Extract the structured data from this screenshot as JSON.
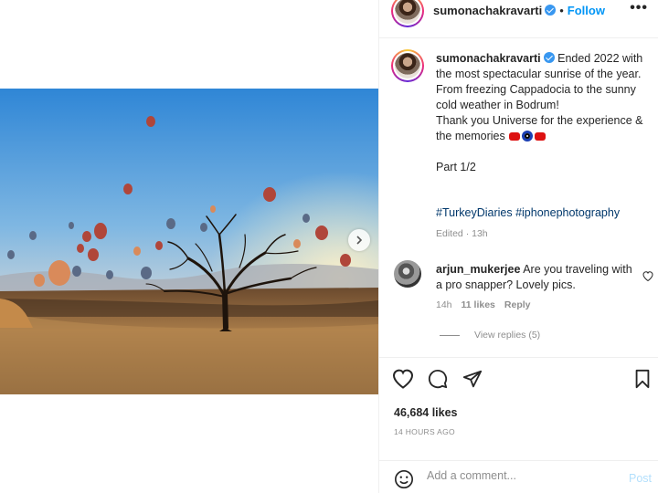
{
  "post": {
    "username": "sumonachakravarti",
    "follow_label": "Follow",
    "dot": "•",
    "more_icon": "more-horizontal-icon",
    "caption_text": " Ended 2022 with the most spectacular sunrise of the year.\nFrom freezing Cappadocia to the sunny cold weather in Bodrum!\nThank you Universe for the experience & the memories ",
    "part": "Part 1/2",
    "hashtags": [
      "#TurkeyDiaries",
      "#iphonephotography"
    ],
    "edited": "Edited · 13h"
  },
  "comment": {
    "username": "arjun_mukerjee",
    "text": "Are you traveling with a pro snapper? Lovely pics.",
    "time": "14h",
    "likes": "11 likes",
    "reply_label": "Reply",
    "view_replies": "View replies (5)"
  },
  "stats": {
    "likes": "46,684 likes",
    "time_ago": "14 HOURS AGO"
  },
  "composer": {
    "placeholder": "Add a comment...",
    "post_label": "Post"
  },
  "colors": {
    "accent": "#0095f6",
    "link": "#00376b",
    "muted": "#8e8e8e"
  }
}
